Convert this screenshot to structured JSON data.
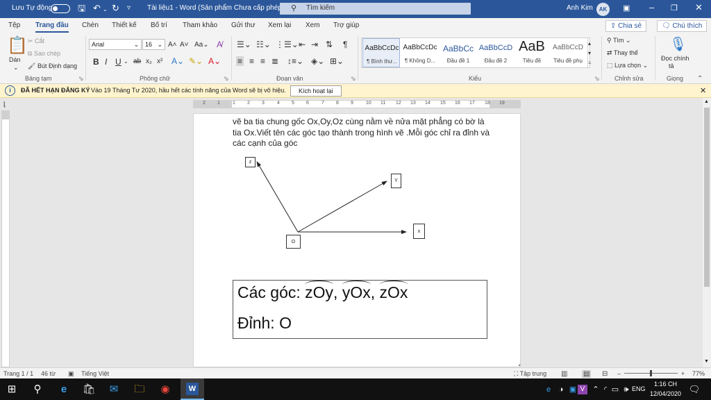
{
  "titlebar": {
    "autosave_label": "Lưu Tự động",
    "doc_title": "Tài liệu1 - Word (Sản phẩm Chưa cấp phép)",
    "search_placeholder": "Tìm kiếm",
    "user_name": "Anh Kim",
    "user_initials": "AK",
    "accent_color": "#2b579a"
  },
  "tabs": [
    {
      "label": "Tệp"
    },
    {
      "label": "Trang đầu",
      "active": true
    },
    {
      "label": "Chèn"
    },
    {
      "label": "Thiết kế"
    },
    {
      "label": "Bố trí"
    },
    {
      "label": "Tham khảo"
    },
    {
      "label": "Gửi thư"
    },
    {
      "label": "Xem lại"
    },
    {
      "label": "Xem"
    },
    {
      "label": "Trợ giúp"
    }
  ],
  "share": {
    "share_label": "Chia sẻ",
    "comments_label": "Chú thích"
  },
  "ribbon": {
    "clipboard": {
      "paste": "Dán",
      "cut": "Cắt",
      "copy": "Sao chép",
      "format_painter": "Bút Định dạng",
      "group": "Bảng tạm"
    },
    "font": {
      "name": "Arial",
      "size": "16",
      "group": "Phông chữ"
    },
    "paragraph": {
      "group": "Đoạn văn"
    },
    "styles": {
      "group": "Kiểu",
      "items": [
        {
          "preview": "AaBbCcDc",
          "name": "¶ Bình thư..."
        },
        {
          "preview": "AaBbCcDc",
          "name": "¶ Không D..."
        },
        {
          "preview": "AaBbCc",
          "name": "Đầu đề 1"
        },
        {
          "preview": "AaBbCcD",
          "name": "Đầu đề 2"
        },
        {
          "preview": "AaB",
          "name": "Tiêu đề"
        },
        {
          "preview": "AaBbCcD",
          "name": "Tiêu đề phụ"
        }
      ]
    },
    "editing": {
      "find": "Tìm",
      "replace": "Thay thế",
      "select": "Lựa chọn",
      "group": "Chỉnh sửa"
    },
    "voice": {
      "dictate_line1": "Đọc chính",
      "dictate_line2": "tả",
      "group": "Giọng"
    }
  },
  "infobar": {
    "title": "ĐÃ HẾT HẠN ĐĂNG KÝ",
    "message": "Vào 19 Tháng Tư 2020, hầu hết các tính năng của Word sẽ bị vô hiệu.",
    "button": "Kích hoạt lại"
  },
  "ruler": {
    "top_numbers": [
      "2",
      "1",
      "1",
      "2",
      "3",
      "4",
      "5",
      "6",
      "7",
      "8",
      "9",
      "10",
      "11",
      "12",
      "13",
      "14",
      "15",
      "16",
      "17",
      "18",
      "19"
    ]
  },
  "document": {
    "paragraph": "vẽ ba tia chung gốc Ox,Oy,Oz cùng nằm về nửa mặt phẳng có bờ là tia Ox.Viết tên các góc tạo thành trong hình vẽ .Mỗi góc chỉ ra đỉnh và các cạnh của góc",
    "diagram": {
      "label_z": "z",
      "label_y": "Y",
      "label_x": "x",
      "label_o": "O"
    },
    "answer": {
      "prefix": "Các góc: ",
      "angle1": "zOy",
      "angle2": "yOx",
      "angle3": "zOx",
      "sep": ", ",
      "vertex_line": "Đỉnh: O"
    }
  },
  "status": {
    "page": "Trang 1 / 1",
    "words": "46 từ",
    "language": "Tiếng Việt",
    "focus": "Tập trung",
    "zoom": "77%",
    "zoom_fraction": 0.5
  },
  "taskbar": {
    "lang": "ENG",
    "time": "1:16 CH",
    "date": "12/04/2020"
  }
}
